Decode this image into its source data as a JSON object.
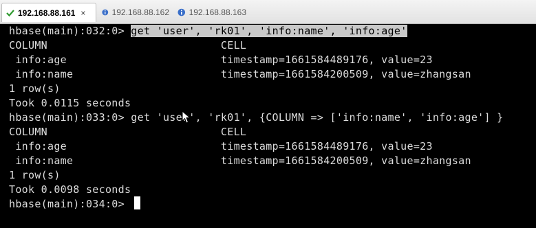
{
  "tabs": [
    {
      "label": "192.168.88.161",
      "active": true,
      "close": "×",
      "icon": "checkmark-icon"
    },
    {
      "label": "192.168.88.162",
      "active": false,
      "icon": "info-icon"
    },
    {
      "label": "192.168.88.163",
      "active": false,
      "icon": "info-icon"
    }
  ],
  "terminal": {
    "lines": [
      "hbase(main):032:0> ",
      "COLUMN                           CELL",
      " info:age                        timestamp=1661584489176, value=23",
      " info:name                       timestamp=1661584200509, value=zhangsan",
      "1 row(s)",
      "Took 0.0115 seconds",
      "hbase(main):033:0> get 'user', 'rk01', {COLUMN => ['info:name', 'info:age'] }",
      "COLUMN                           CELL",
      " info:age                        timestamp=1661584489176, value=23",
      " info:name                       timestamp=1661584200509, value=zhangsan",
      "1 row(s)",
      "Took 0.0098 seconds",
      "hbase(main):034:0> "
    ],
    "selected_command": "get 'user', 'rk01', 'info:name', 'info:age'"
  }
}
